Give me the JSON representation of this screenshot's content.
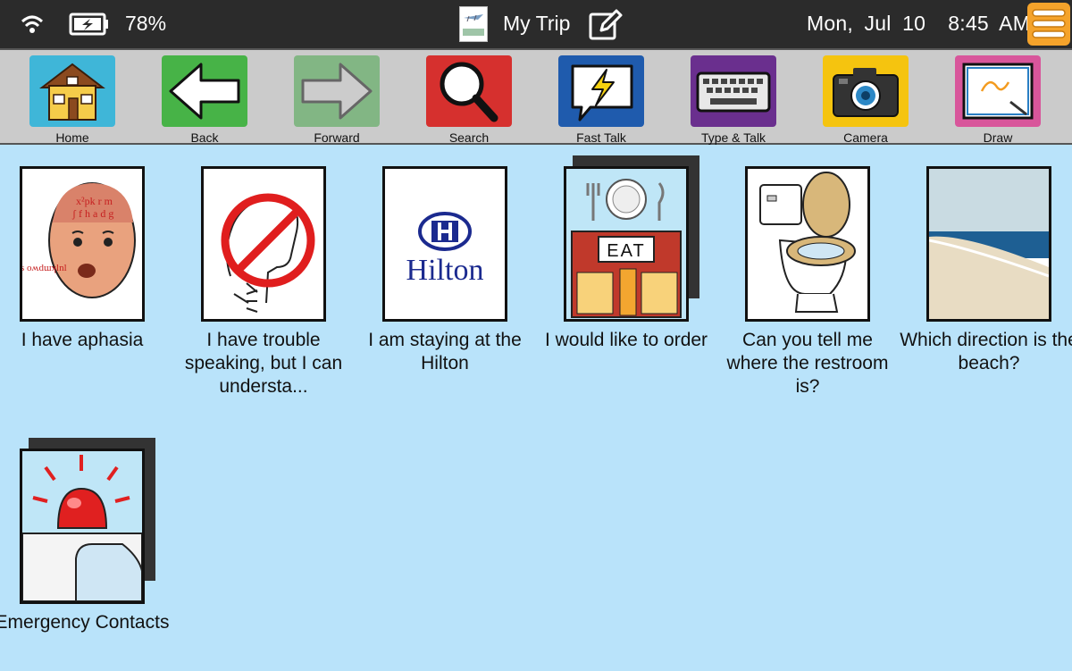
{
  "status": {
    "battery_percent": "78%",
    "title": "My Trip",
    "date": "Mon, Jul 10",
    "time": "8:45 AM"
  },
  "toolbar": [
    {
      "label": "Home",
      "color": "#3fb6d8",
      "icon": "house-icon"
    },
    {
      "label": "Back",
      "color": "#47b347",
      "icon": "arrow-left-icon"
    },
    {
      "label": "Forward",
      "color": "#82b684",
      "icon": "arrow-right-icon"
    },
    {
      "label": "Search",
      "color": "#d6302e",
      "icon": "magnifier-icon"
    },
    {
      "label": "Fast Talk",
      "color": "#1f5bad",
      "icon": "speech-bolt-icon"
    },
    {
      "label": "Type & Talk",
      "color": "#6a2f8e",
      "icon": "keyboard-icon"
    },
    {
      "label": "Camera",
      "color": "#f5c40f",
      "icon": "camera-icon"
    },
    {
      "label": "Draw",
      "color": "#d8569b",
      "icon": "drawing-board-icon"
    }
  ],
  "cells": [
    {
      "caption": "I have aphasia",
      "icon": "aphasia-head-icon"
    },
    {
      "caption": "I have trouble speaking, but I can understa...",
      "icon": "no-speaking-icon"
    },
    {
      "caption": "I am staying at the Hilton",
      "icon": "hilton-logo",
      "logo_text": "Hilton"
    },
    {
      "caption": "I would like to order",
      "icon": "restaurant-icon",
      "sign_text": "EAT"
    },
    {
      "caption": "Can you tell me where the restroom is?",
      "icon": "toilet-icon"
    },
    {
      "caption": "Which direction is the beach?",
      "icon": "beach-photo"
    },
    {
      "caption": "Emergency Contacts",
      "icon": "emergency-siren-icon"
    }
  ]
}
